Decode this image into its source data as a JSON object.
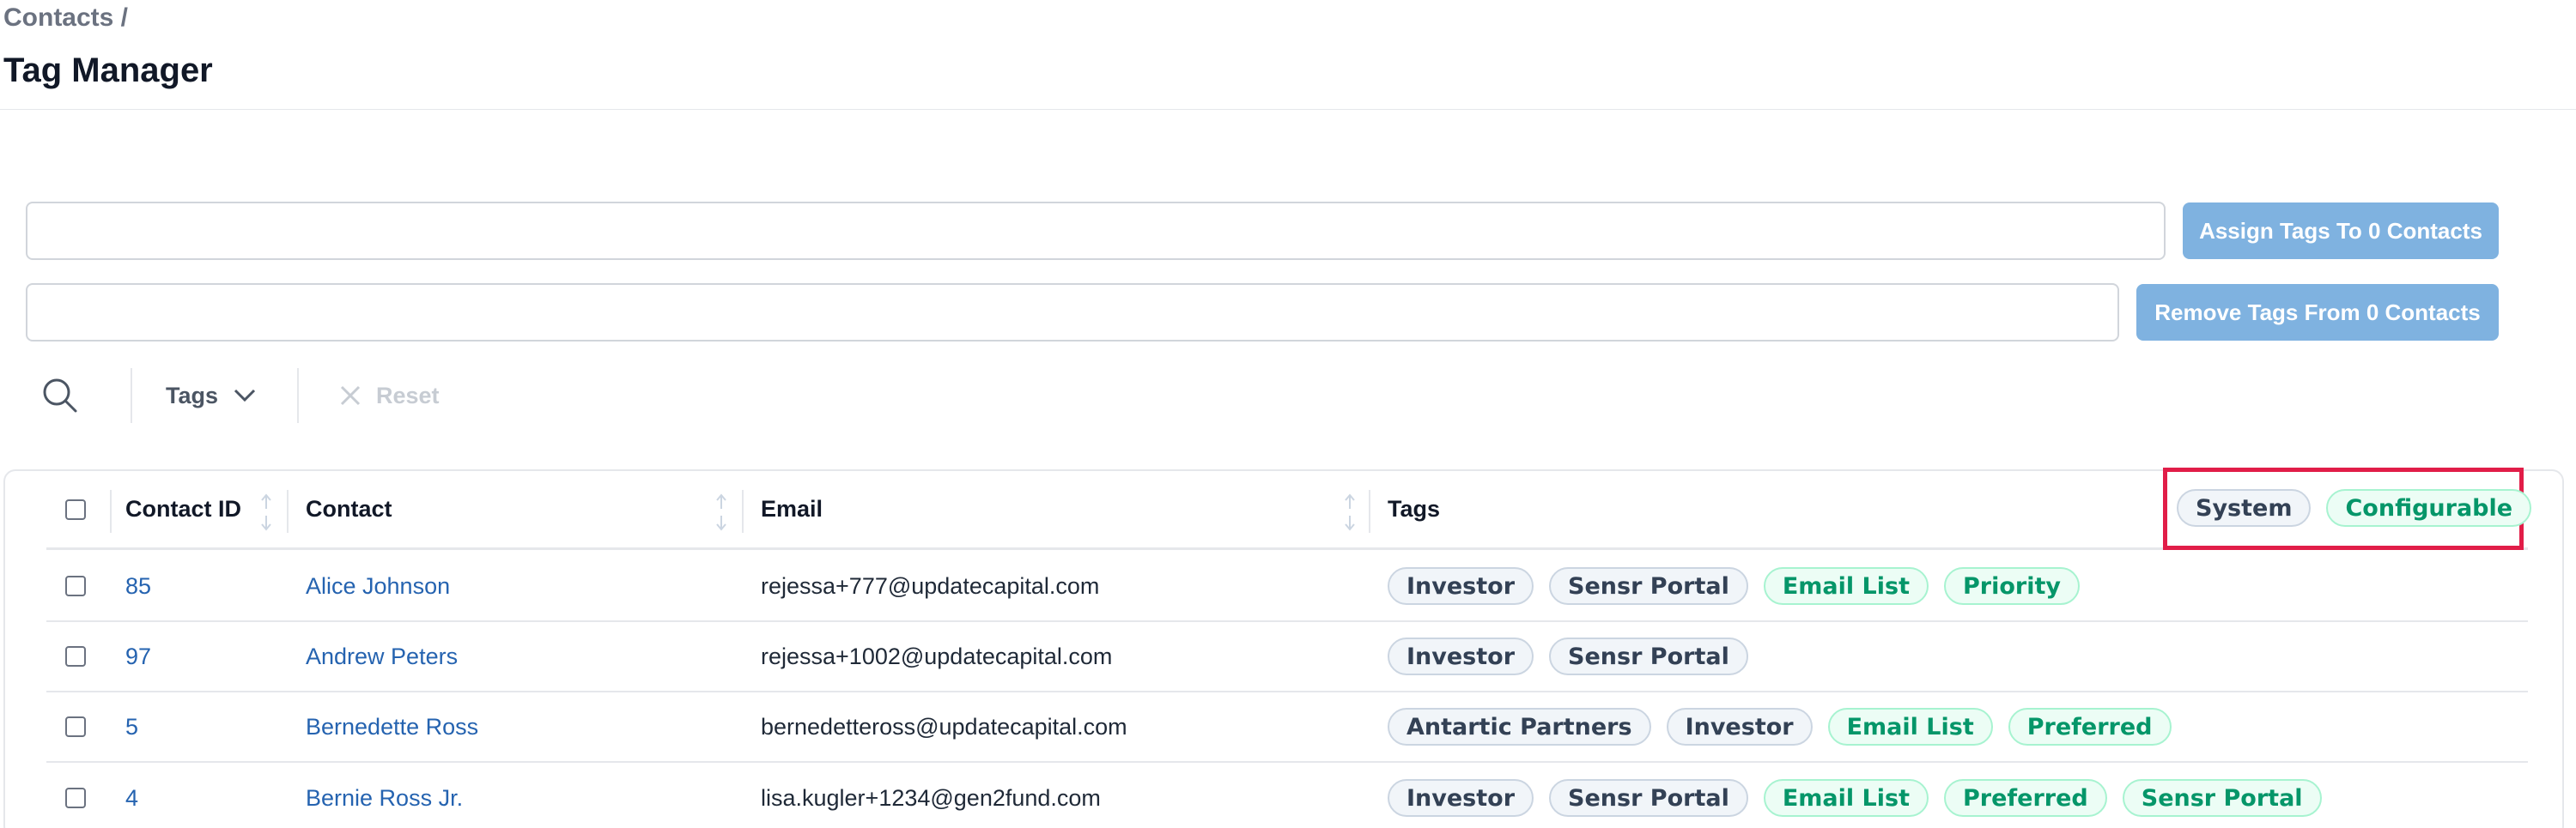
{
  "breadcrumb": "Contacts /",
  "page_title": "Tag Manager",
  "assign_input": {
    "placeholder": "",
    "value": ""
  },
  "remove_input": {
    "placeholder": "",
    "value": ""
  },
  "assign_button": "Assign Tags To 0 Contacts",
  "remove_button": "Remove Tags From 0 Contacts",
  "filters": {
    "search_icon": "search-icon",
    "tags_label": "Tags",
    "reset_label": "Reset"
  },
  "table": {
    "columns": [
      "Contact ID",
      "Contact",
      "Email",
      "Tags"
    ],
    "legend": {
      "system": "System",
      "configurable": "Configurable"
    },
    "rows": [
      {
        "id": "85",
        "contact": "Alice Johnson",
        "email": "rejessa+777@updatecapital.com",
        "tags": [
          {
            "label": "Investor",
            "kind": "system"
          },
          {
            "label": "Sensr Portal",
            "kind": "system"
          },
          {
            "label": "Email List",
            "kind": "configurable"
          },
          {
            "label": "Priority",
            "kind": "configurable"
          }
        ]
      },
      {
        "id": "97",
        "contact": "Andrew Peters",
        "email": "rejessa+1002@updatecapital.com",
        "tags": [
          {
            "label": "Investor",
            "kind": "system"
          },
          {
            "label": "Sensr Portal",
            "kind": "system"
          }
        ]
      },
      {
        "id": "5",
        "contact": "Bernedette Ross",
        "email": "bernedetteross@updatecapital.com",
        "tags": [
          {
            "label": "Antartic Partners",
            "kind": "system"
          },
          {
            "label": "Investor",
            "kind": "system"
          },
          {
            "label": "Email List",
            "kind": "configurable"
          },
          {
            "label": "Preferred",
            "kind": "configurable"
          }
        ]
      },
      {
        "id": "4",
        "contact": "Bernie Ross Jr.",
        "email": "lisa.kugler+1234@gen2fund.com",
        "tags": [
          {
            "label": "Investor",
            "kind": "system"
          },
          {
            "label": "Sensr Portal",
            "kind": "system"
          },
          {
            "label": "Email List",
            "kind": "configurable"
          },
          {
            "label": "Preferred",
            "kind": "configurable"
          },
          {
            "label": "Sensr Portal",
            "kind": "configurable"
          }
        ]
      }
    ]
  },
  "colors": {
    "button_bg": "#7fb2e0",
    "link": "#2563b0",
    "system_tag_text": "#334155",
    "configurable_tag_text": "#059669",
    "highlight_box": "#e11d48"
  }
}
